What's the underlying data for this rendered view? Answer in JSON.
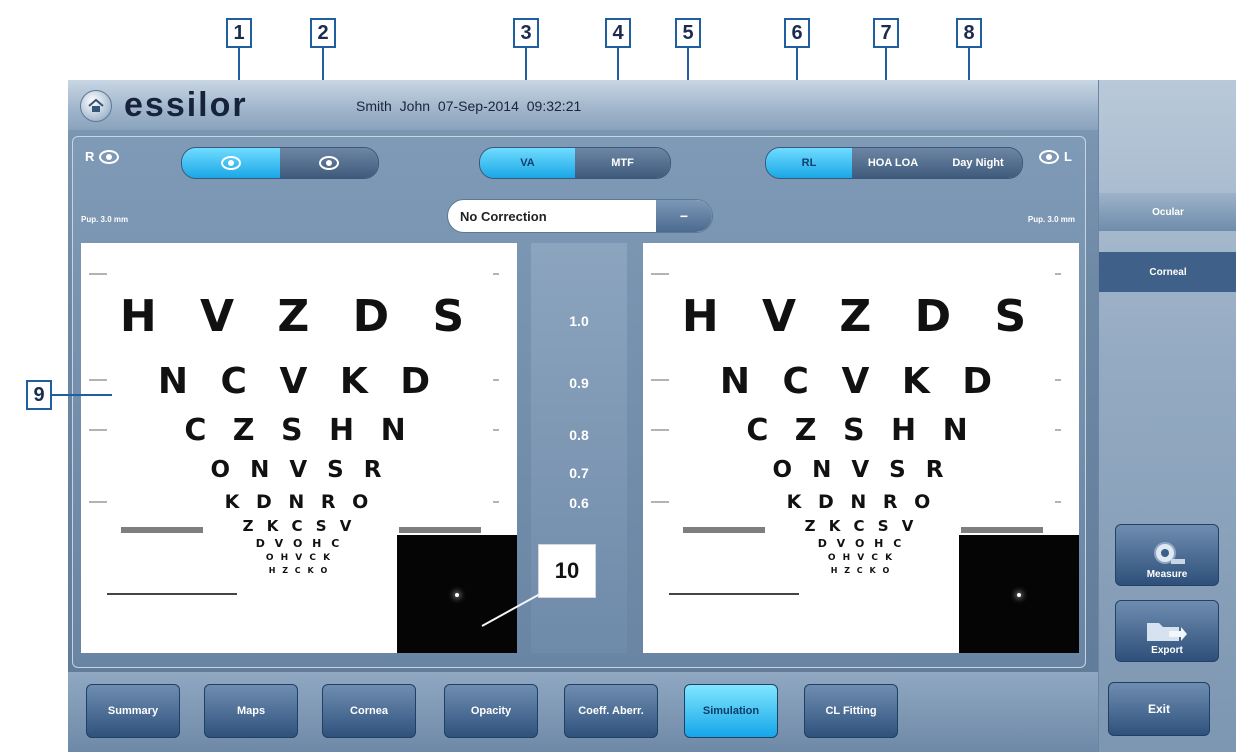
{
  "callouts": [
    "1",
    "2",
    "3",
    "4",
    "5",
    "6",
    "7",
    "8",
    "9",
    "10"
  ],
  "header": {
    "logo": "essilor",
    "patient_info": "Smith John  07-Sep-2014  09:32:21"
  },
  "main": {
    "right_eye_label": "R",
    "left_eye_label": "L",
    "view_toggle": {
      "options": [
        "",
        ""
      ],
      "active_index": 0
    },
    "metric_toggle": {
      "options": [
        "VA",
        "MTF"
      ],
      "active": "VA"
    },
    "display_toggle": {
      "options": [
        "RL",
        "HOA LOA",
        "Day Night"
      ],
      "active": "RL"
    },
    "correction": {
      "value": "No Correction",
      "arrow": "−"
    },
    "pupil_left": "Pup. 3.0 mm",
    "pupil_right": "Pup. 3.0 mm",
    "chart_rows": [
      {
        "letters": "H V Z D S",
        "acuity": "1.0"
      },
      {
        "letters": "N C V K D",
        "acuity": "0.9"
      },
      {
        "letters": "C Z S H N",
        "acuity": "0.8"
      },
      {
        "letters": "O N V S R",
        "acuity": "0.7"
      },
      {
        "letters": "K D N R O",
        "acuity": "0.6"
      },
      {
        "letters": "Z K C S V",
        "acuity": ""
      },
      {
        "letters": "D V O H C",
        "acuity": ""
      },
      {
        "letters": "O H V C K",
        "acuity": ""
      },
      {
        "letters": "H Z C K O",
        "acuity": ""
      }
    ]
  },
  "right_panel": {
    "tabs": [
      "Ocular",
      "Corneal"
    ],
    "active_tab": "Corneal",
    "measure_label": "Measure",
    "export_label": "Export"
  },
  "bottom_nav": {
    "items": [
      "Summary",
      "Maps",
      "Cornea",
      "Opacity",
      "Coeff. Aberr.",
      "Simulation",
      "CL Fitting"
    ],
    "active": "Simulation",
    "exit_label": "Exit"
  },
  "icons": {
    "home": "home-icon",
    "eye": "eye-icon",
    "measure": "measure-icon",
    "export": "folder-arrow-icon"
  }
}
